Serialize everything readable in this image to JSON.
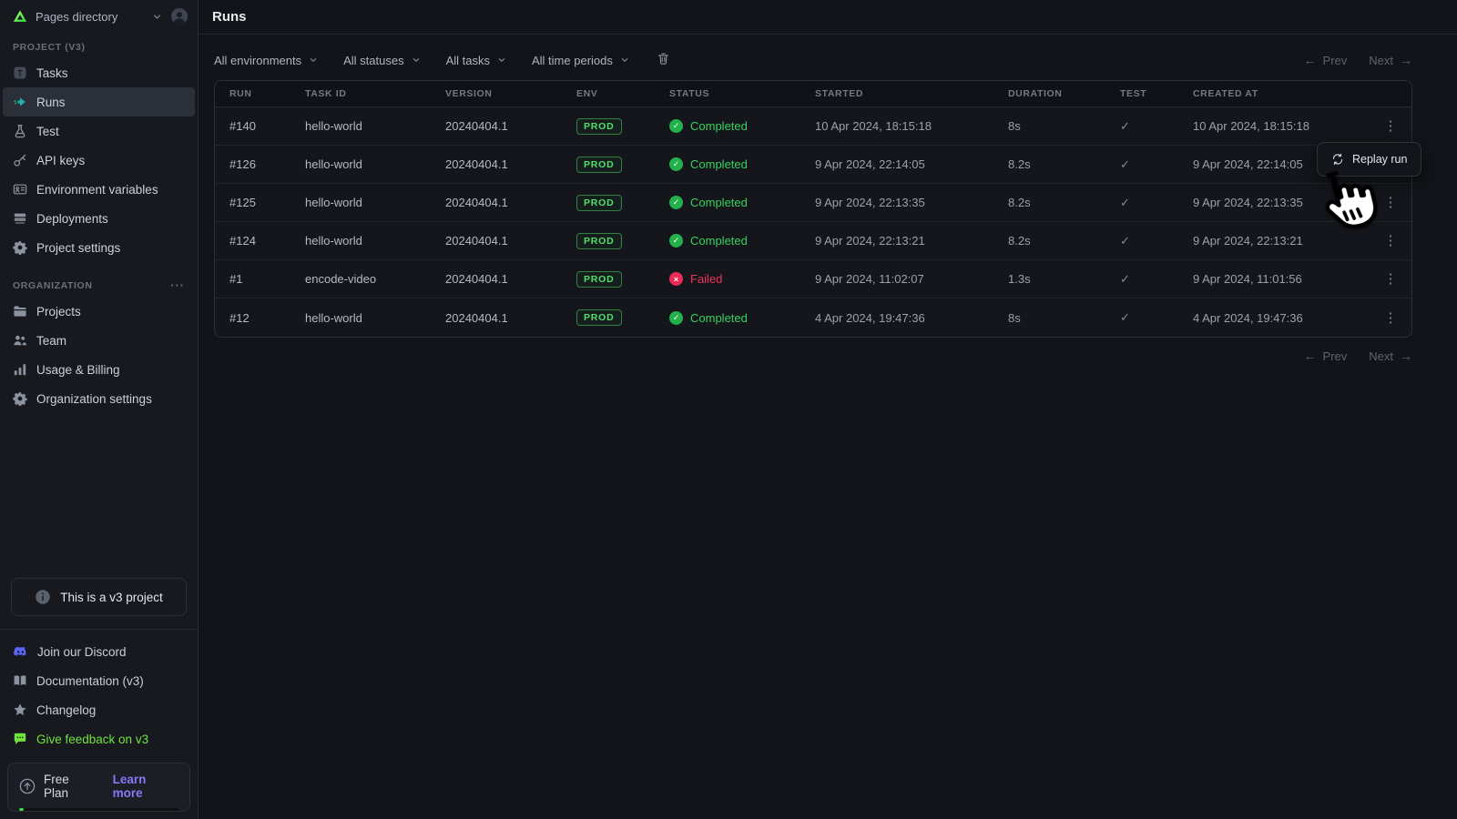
{
  "sidebar": {
    "workspace": "Pages directory",
    "project_section": {
      "label": "PROJECT (V3)",
      "items": [
        {
          "id": "tasks",
          "label": "Tasks",
          "icon": "tasks-icon",
          "active": false
        },
        {
          "id": "runs",
          "label": "Runs",
          "icon": "runs-icon",
          "active": true
        },
        {
          "id": "test",
          "label": "Test",
          "icon": "flask-icon",
          "active": false
        },
        {
          "id": "api-keys",
          "label": "API keys",
          "icon": "key-icon",
          "active": false
        },
        {
          "id": "environment-variables",
          "label": "Environment variables",
          "icon": "idcard-icon",
          "active": false
        },
        {
          "id": "deployments",
          "label": "Deployments",
          "icon": "server-icon",
          "active": false
        },
        {
          "id": "project-settings",
          "label": "Project settings",
          "icon": "gear-icon",
          "active": false
        }
      ]
    },
    "organization_section": {
      "label": "ORGANIZATION",
      "items": [
        {
          "id": "projects",
          "label": "Projects",
          "icon": "folder-icon",
          "active": false
        },
        {
          "id": "team",
          "label": "Team",
          "icon": "team-icon",
          "active": false
        },
        {
          "id": "usage-billing",
          "label": "Usage & Billing",
          "icon": "chart-icon",
          "active": false
        },
        {
          "id": "organization-settings",
          "label": "Organization settings",
          "icon": "gear-icon",
          "active": false
        }
      ]
    },
    "v3_notice": "This is a v3 project",
    "bottom_links": [
      {
        "id": "discord",
        "label": "Join our Discord",
        "icon": "discord-icon",
        "color": "#C9CFD8"
      },
      {
        "id": "documentation",
        "label": "Documentation (v3)",
        "icon": "book-icon",
        "color": "#C9CFD8"
      },
      {
        "id": "changelog",
        "label": "Changelog",
        "icon": "star-icon",
        "color": "#C9CFD8"
      },
      {
        "id": "feedback",
        "label": "Give feedback on v3",
        "icon": "feedback-icon",
        "color": "#6FE43F"
      }
    ],
    "plan": {
      "name": "Free Plan",
      "link_label": "Learn more",
      "usage_percent": 3
    }
  },
  "header": {
    "title": "Runs"
  },
  "filters": [
    {
      "label": "All environments"
    },
    {
      "label": "All statuses"
    },
    {
      "label": "All tasks"
    },
    {
      "label": "All time periods"
    }
  ],
  "pagination": {
    "prev_label": "Prev",
    "next_label": "Next"
  },
  "table": {
    "columns": [
      "RUN",
      "TASK ID",
      "VERSION",
      "ENV",
      "STATUS",
      "STARTED",
      "DURATION",
      "TEST",
      "CREATED AT"
    ],
    "rows": [
      {
        "run": "#140",
        "task_id": "hello-world",
        "version": "20240404.1",
        "env": "PROD",
        "status": "Completed",
        "status_type": "success",
        "started": "10 Apr 2024, 18:15:18",
        "duration": "8s",
        "test": true,
        "created_at": "10 Apr 2024, 18:15:18"
      },
      {
        "run": "#126",
        "task_id": "hello-world",
        "version": "20240404.1",
        "env": "PROD",
        "status": "Completed",
        "status_type": "success",
        "started": "9 Apr 2024, 22:14:05",
        "duration": "8.2s",
        "test": true,
        "created_at": "9 Apr 2024, 22:14:05"
      },
      {
        "run": "#125",
        "task_id": "hello-world",
        "version": "20240404.1",
        "env": "PROD",
        "status": "Completed",
        "status_type": "success",
        "started": "9 Apr 2024, 22:13:35",
        "duration": "8.2s",
        "test": true,
        "created_at": "9 Apr 2024, 22:13:35"
      },
      {
        "run": "#124",
        "task_id": "hello-world",
        "version": "20240404.1",
        "env": "PROD",
        "status": "Completed",
        "status_type": "success",
        "started": "9 Apr 2024, 22:13:21",
        "duration": "8.2s",
        "test": true,
        "created_at": "9 Apr 2024, 22:13:21"
      },
      {
        "run": "#1",
        "task_id": "encode-video",
        "version": "20240404.1",
        "env": "PROD",
        "status": "Failed",
        "status_type": "error",
        "started": "9 Apr 2024, 11:02:07",
        "duration": "1.3s",
        "test": true,
        "created_at": "9 Apr 2024, 11:01:56"
      },
      {
        "run": "#12",
        "task_id": "hello-world",
        "version": "20240404.1",
        "env": "PROD",
        "status": "Completed",
        "status_type": "success",
        "started": "4 Apr 2024, 19:47:36",
        "duration": "8s",
        "test": true,
        "created_at": "4 Apr 2024, 19:47:36"
      }
    ]
  },
  "context_menu": {
    "label": "Replay run"
  },
  "glyphs": {
    "test_check": "✓",
    "row_menu": "⋮",
    "arrow_left": "←",
    "arrow_right": "→",
    "org_menu": "···",
    "status_check": "✓",
    "status_x": "×"
  },
  "colors": {
    "success_green": "#28C248",
    "error_red": "#EB2B55",
    "runs_teal": "#1FB6A6",
    "prod_badge": "#53DF6C",
    "discord_blurple": "#5865F2",
    "feedback_green": "#6FE43F",
    "link_purple": "#8B77F7"
  }
}
